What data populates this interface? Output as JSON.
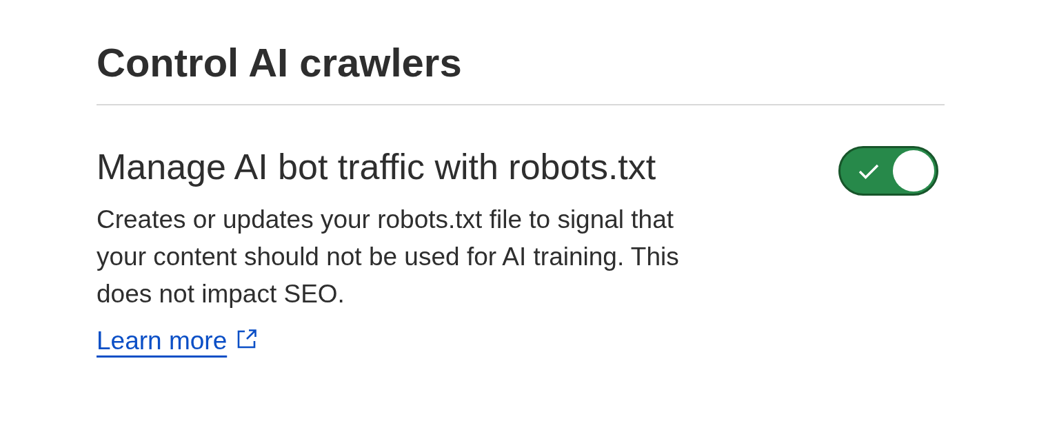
{
  "page": {
    "title": "Control AI crawlers"
  },
  "setting": {
    "title": "Manage AI bot traffic with robots.txt",
    "description": "Creates or updates your robots.txt file to signal that your content should not be used for AI training. This does not impact SEO.",
    "link": {
      "label": "Learn more"
    },
    "toggle": {
      "on": true
    }
  }
}
